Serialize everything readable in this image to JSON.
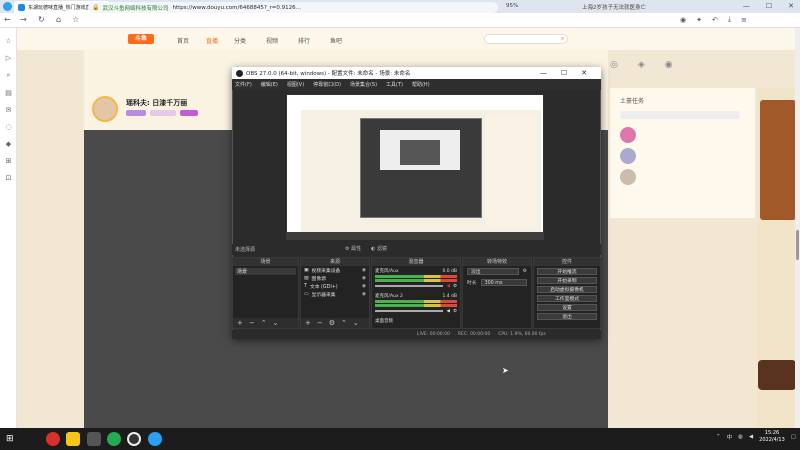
{
  "browser": {
    "tab_title": "东湖玩德味直播_热门游戏直播_丰...",
    "url_company": "武汉斗鱼网络科技有限公司",
    "url": "https://www.douyu.com/6468845?_r=0.9126... ",
    "zoom": "95%",
    "hot_news": "上海2岁孩子无法就医身亡"
  },
  "douyu": {
    "logo": "斗鱼",
    "nav": [
      "首页",
      "直播",
      "分类",
      "视频",
      "排行",
      "鱼吧"
    ],
    "anchor_name": "瑶科夫: 日漆千万丽",
    "level": "12",
    "right_panel_title": "土豪任务"
  },
  "obs": {
    "title": "OBS 27.0.0 (64-bit, windows) - 配置文件: 未命名 - 场景: 未命名",
    "menu": [
      "文件(F)",
      "编辑(E)",
      "视图(V)",
      "停靠窗口(D)",
      "场景集合(S)",
      "工具(T)",
      "帮助(H)"
    ],
    "no_source": "未选择源",
    "properties": "属性",
    "filters": "滤镜",
    "docks": {
      "scenes": "场景",
      "sources": "来源",
      "mixer": "混音器",
      "transitions": "转场特效",
      "controls": "控件"
    },
    "scenes": [
      "场景"
    ],
    "sources": [
      "视频采集设备",
      "图像源",
      "文本 (GDI+)",
      "显示器采集"
    ],
    "mixer": [
      {
        "name": "麦克风/Aux",
        "db": "0.0 dB"
      },
      {
        "name": "麦克风/Aux 2",
        "db": "1.4 dB"
      },
      {
        "name": "桌面音频",
        "db": ""
      }
    ],
    "transition": "淡出",
    "duration_label": "时长",
    "duration": "300 ms",
    "controls": [
      "开始推流",
      "开始录制",
      "启动虚拟摄像机",
      "工作室模式",
      "设置",
      "退出"
    ],
    "status": [
      "LIVE: 00:00:00",
      "REC: 00:00:00",
      "CPU: 1.9%, 60.00 fps"
    ]
  },
  "taskbar": {
    "time": "15:26",
    "date": "2022/4/13",
    "ime": "中"
  }
}
